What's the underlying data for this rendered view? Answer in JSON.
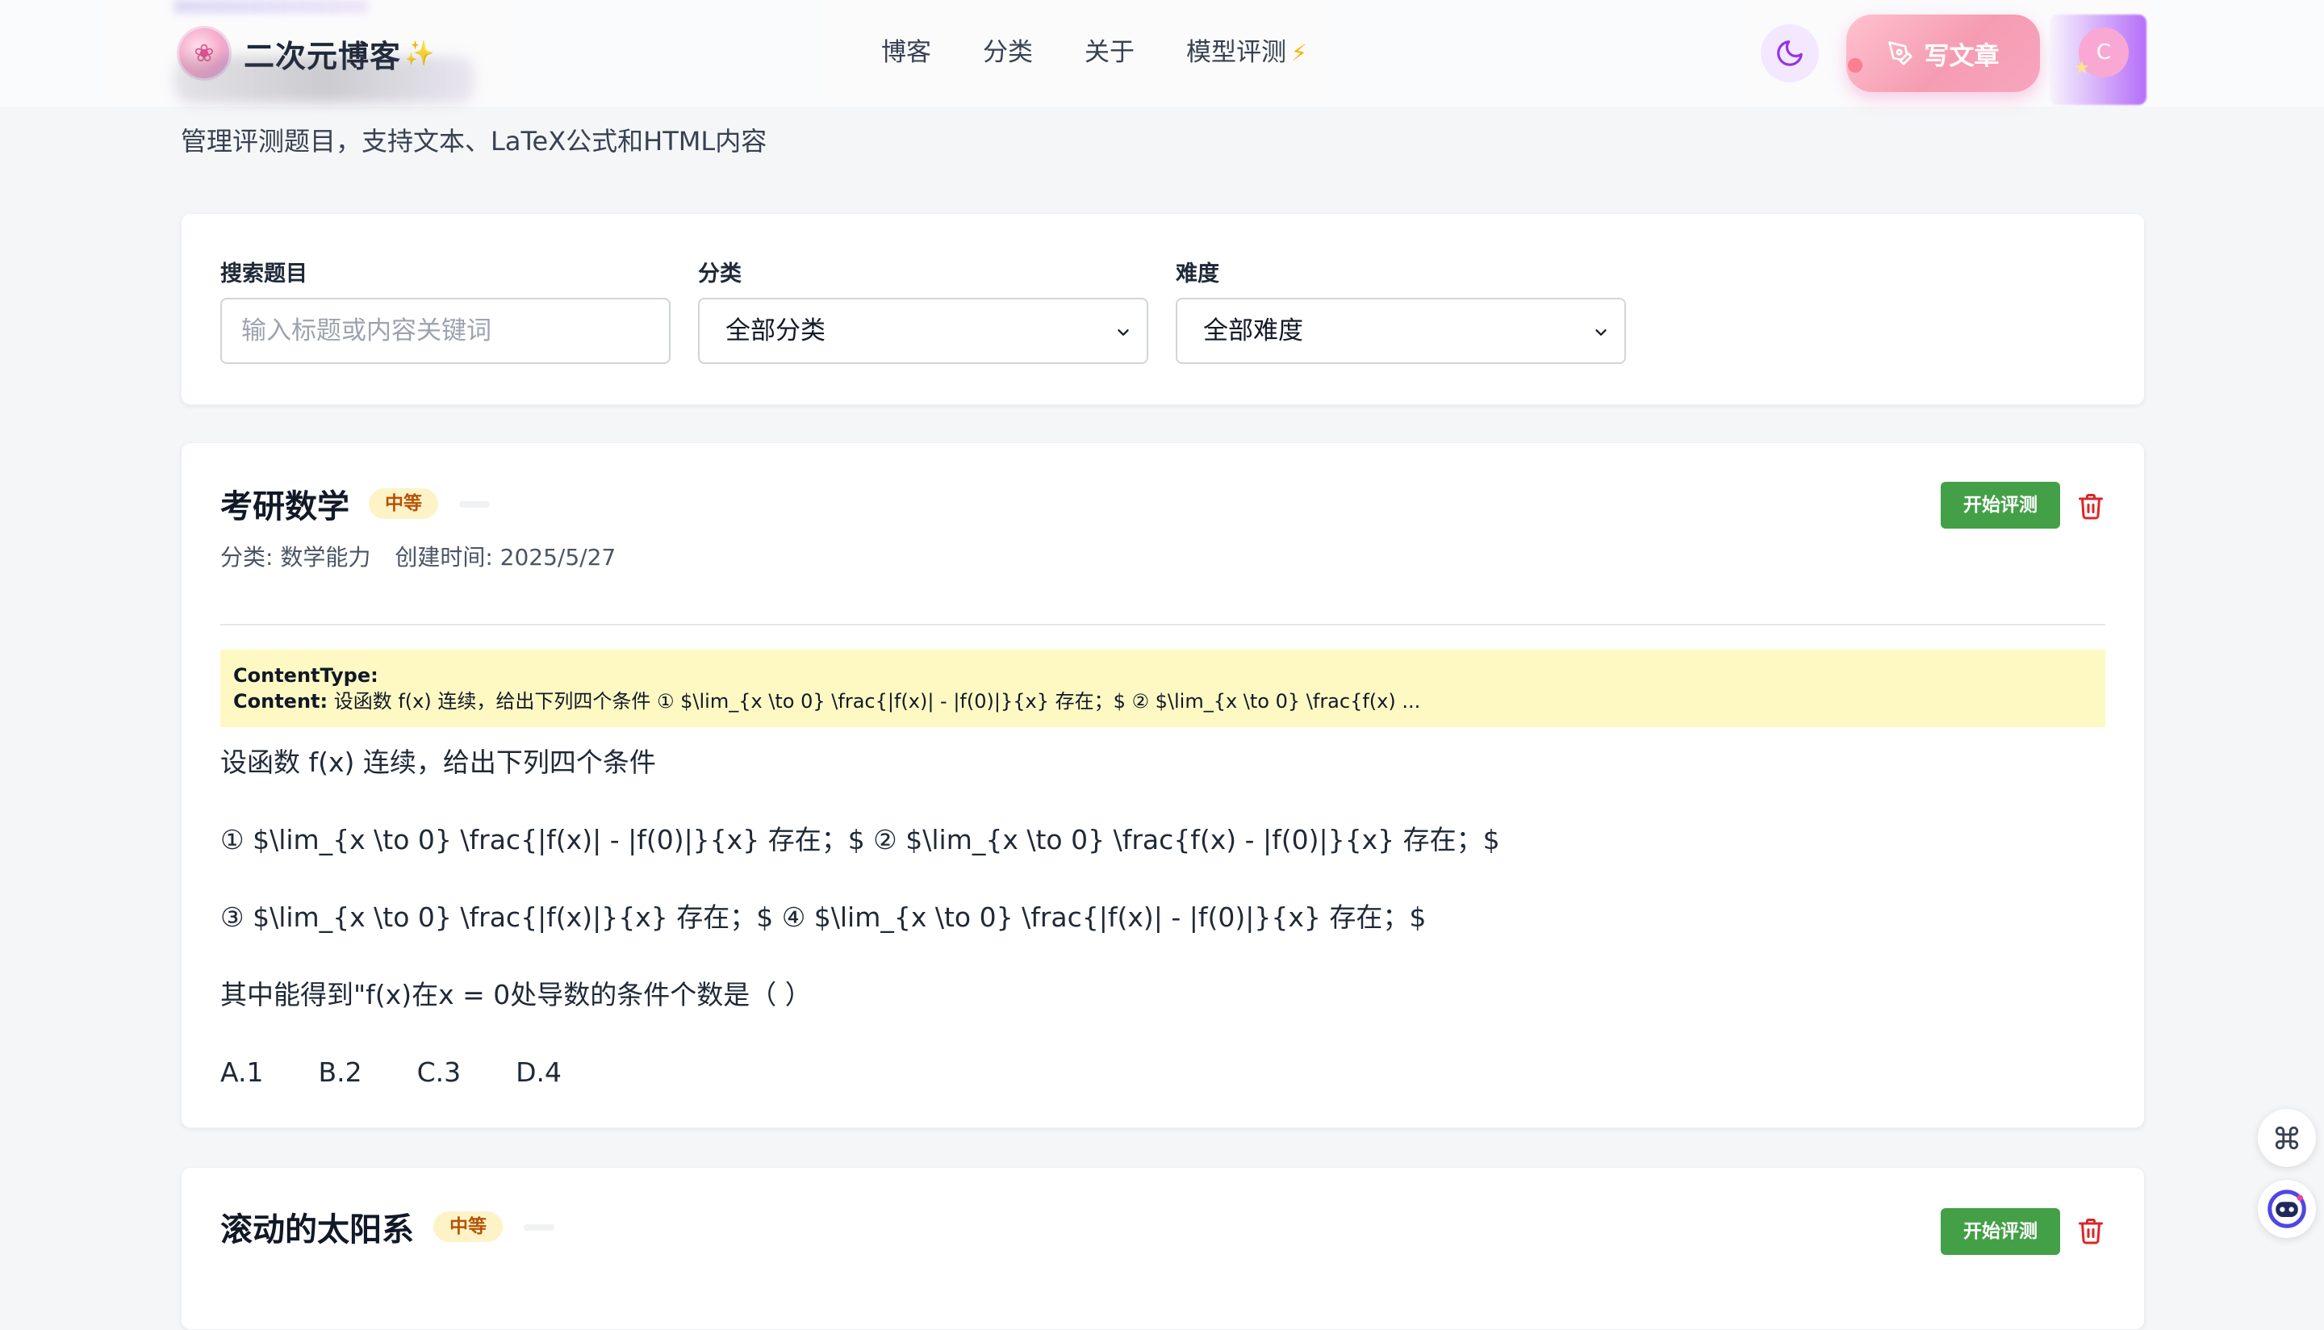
{
  "header": {
    "logo_title": "二次元博客",
    "logo_spark": "✨",
    "nav": [
      {
        "label": "博客"
      },
      {
        "label": "分类"
      },
      {
        "label": "关于"
      },
      {
        "label": "模型评测",
        "icon": "⚡"
      }
    ],
    "write_label": "写文章",
    "user_initial": "C"
  },
  "subtitle": "管理评测题目，支持文本、LaTeX公式和HTML内容",
  "filters": {
    "search_label": "搜索题目",
    "search_placeholder": "输入标题或内容关键词",
    "category_label": "分类",
    "category_value": "全部分类",
    "difficulty_label": "难度",
    "difficulty_value": "全部难度"
  },
  "questions": [
    {
      "title": "考研数学",
      "difficulty": "中等",
      "category": "分类: 数学能力",
      "created": "创建时间: 2025/5/27",
      "start_label": "开始评测",
      "debug_type_label": "ContentType:",
      "debug_content_label": "Content:",
      "debug_content": "设函数 f(x) 连续，给出下列四个条件 ① $\\lim_{x \\to 0} \\frac{|f(x)| - |f(0)|}{x} 存在；$ ② $\\lim_{x \\to 0} \\frac{f(x) ...",
      "body": [
        "设函数 f(x) 连续，给出下列四个条件",
        "① $\\lim_{x \\to 0} \\frac{|f(x)| - |f(0)|}{x} 存在；$ ② $\\lim_{x \\to 0} \\frac{f(x) - |f(0)|}{x} 存在；$",
        "③ $\\lim_{x \\to 0} \\frac{|f(x)|}{x} 存在；$ ④ $\\lim_{x \\to 0} \\frac{|f(x)| - |f(0)|}{x} 存在；$",
        "其中能得到\"f(x)在x = 0处导数的条件个数是（    ）"
      ],
      "options": [
        "A.1",
        "B.2",
        "C.3",
        "D.4"
      ]
    },
    {
      "title": "滚动的太阳系",
      "difficulty": "中等",
      "start_label": "开始评测"
    }
  ],
  "colors": {
    "accent_green": "#43a047",
    "badge_bg": "#fef3c7",
    "badge_text": "#b45309",
    "debug_bg": "#fef9c3",
    "trash_red": "#dc2626",
    "write_btn_pink": "#f59cb1"
  }
}
